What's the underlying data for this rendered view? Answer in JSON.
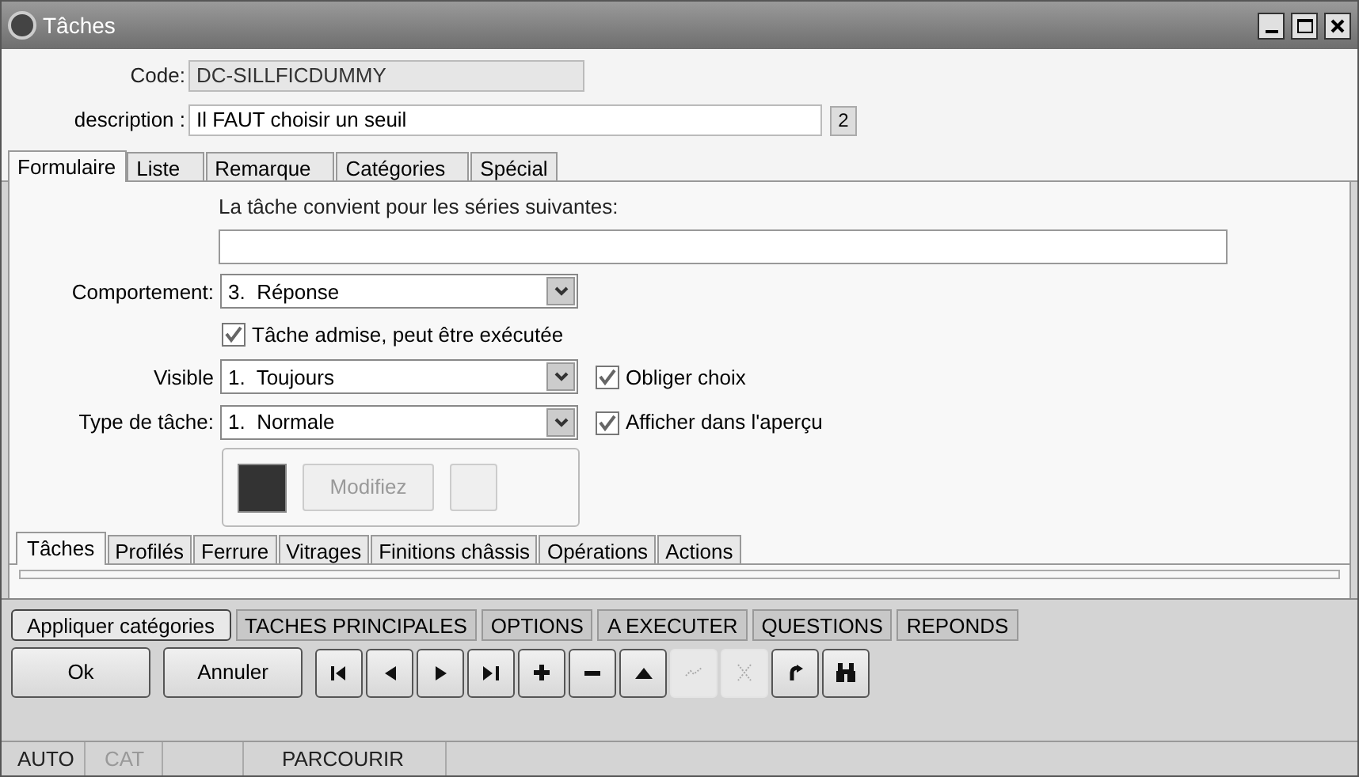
{
  "window": {
    "title": "Tâches"
  },
  "code": {
    "label": "Code:",
    "value": "DC-SILLFICDUMMY",
    "disabled": true
  },
  "description": {
    "label": "description :",
    "value": "Il FAUT choisir un seuil",
    "badge": "2"
  },
  "tabs": [
    {
      "label": "Formulaire",
      "selected": true
    },
    {
      "label": "Liste",
      "selected": false
    },
    {
      "label": "Remarque",
      "selected": false
    },
    {
      "label": "Catégories",
      "selected": false
    },
    {
      "label": "Spécial",
      "selected": false
    }
  ],
  "series": {
    "label": "La tâche convient pour les séries suivantes:"
  },
  "comportement": {
    "label": "Comportement:",
    "value": "3.  Réponse"
  },
  "admise": {
    "label": "Tâche admise, peut être exécutée",
    "checked": true
  },
  "visible": {
    "label": "Visible",
    "value": "1.  Toujours",
    "check": {
      "label": "Obliger choix",
      "checked": true
    }
  },
  "type": {
    "label": "Type de tâche:",
    "value": "1.  Normale",
    "check": {
      "label": "Afficher dans l'aperçu",
      "checked": true
    }
  },
  "color_box": {
    "color": "#333333",
    "button": {
      "label": "Modifiez",
      "disabled": true
    }
  },
  "sub_tabs": [
    {
      "label": "Tâches",
      "selected": true
    },
    {
      "label": "Profilés",
      "selected": false
    },
    {
      "label": "Ferrure",
      "selected": false
    },
    {
      "label": "Vitrages",
      "selected": false
    },
    {
      "label": "Finitions châssis",
      "selected": false
    },
    {
      "label": "Opérations",
      "selected": false
    },
    {
      "label": "Actions",
      "selected": false
    }
  ],
  "category_buttons": [
    {
      "label": "Appliquer catégories",
      "selected": true
    },
    {
      "label": "TACHES PRINCIPALES",
      "selected": false
    },
    {
      "label": "OPTIONS",
      "selected": false
    },
    {
      "label": "A EXECUTER",
      "selected": false
    },
    {
      "label": "QUESTIONS",
      "selected": false
    },
    {
      "label": "REPONDS",
      "selected": false
    }
  ],
  "buttons": [
    {
      "label": "Ok"
    },
    {
      "label": "Annuler"
    }
  ],
  "toolbar": [
    {
      "kind": "first",
      "disabled": false
    },
    {
      "kind": "prev",
      "disabled": false
    },
    {
      "kind": "next",
      "disabled": false
    },
    {
      "kind": "last",
      "disabled": false
    },
    {
      "kind": "add",
      "disabled": false
    },
    {
      "kind": "remove",
      "disabled": false
    },
    {
      "kind": "up",
      "disabled": false
    },
    {
      "kind": "confirm",
      "disabled": true
    },
    {
      "kind": "cancel",
      "disabled": true
    },
    {
      "kind": "refresh",
      "disabled": false
    },
    {
      "kind": "search",
      "disabled": false
    }
  ],
  "status_bar": [
    {
      "text": "AUTO",
      "disabled": false
    },
    {
      "text": "CAT",
      "disabled": true
    },
    {
      "text": "PARCOURIR",
      "disabled": false
    }
  ]
}
